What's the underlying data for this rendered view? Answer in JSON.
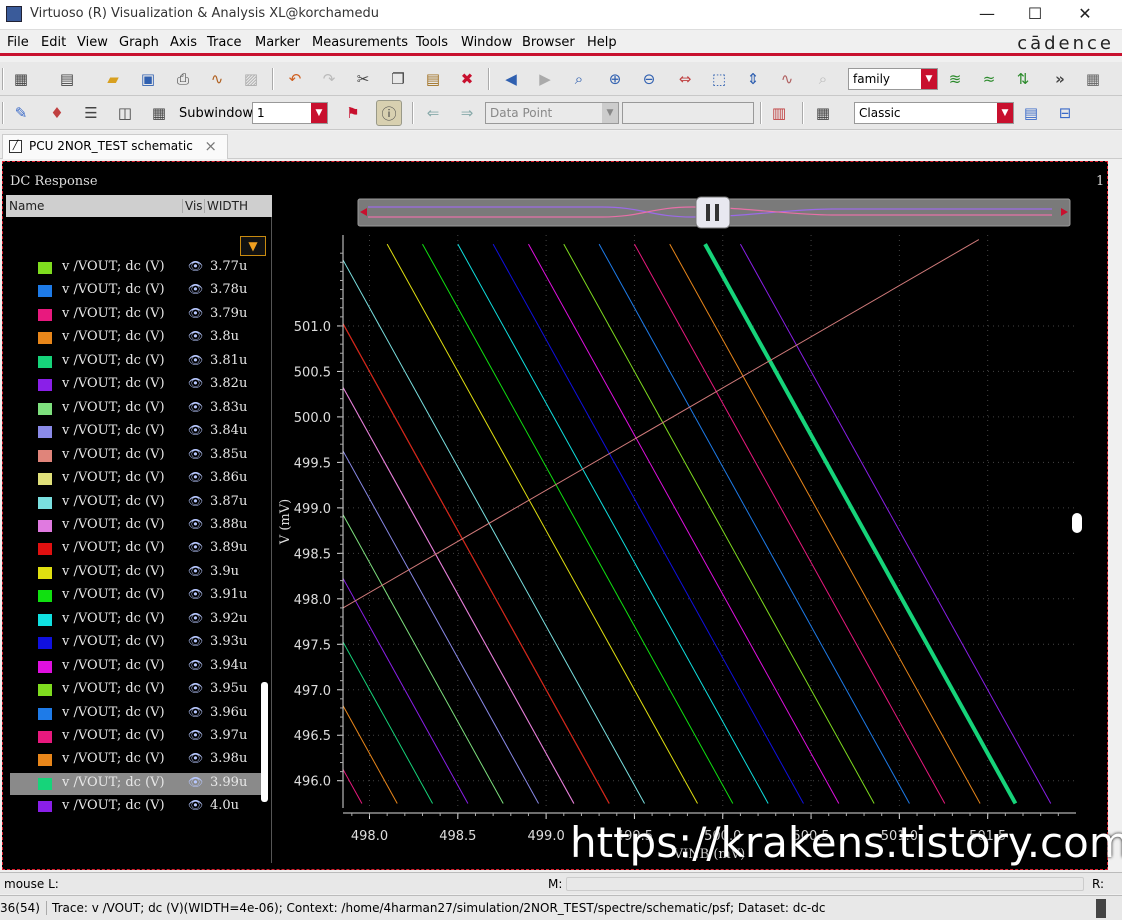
{
  "window": {
    "title": "Virtuoso (R) Visualization & Analysis XL@korchamedu",
    "minimize": "—",
    "maximize": "☐",
    "close": "✕"
  },
  "menu": {
    "items": [
      "File",
      "Edit",
      "View",
      "Graph",
      "Axis",
      "Trace",
      "Marker",
      "Measurements",
      "Tools",
      "Window",
      "Browser",
      "Help"
    ],
    "brand": "cādence"
  },
  "toolbar1": {
    "family_combo": "family",
    "more": "»"
  },
  "toolbar2": {
    "subwindow_label": "Subwindow:",
    "subwindow_value": "1",
    "datapoint_combo": "Data Point",
    "style_combo": "Classic"
  },
  "tab": {
    "label": "PCU 2NOR_TEST schematic",
    "close": "×"
  },
  "panel": {
    "title": "DC Response",
    "corner_number": "1",
    "columns": [
      "Name",
      "Vis",
      "WIDTH"
    ]
  },
  "traces": [
    {
      "name": "v /VOUT; dc (V)",
      "width": "3.77u",
      "color": "#7fdc1f"
    },
    {
      "name": "v /VOUT; dc (V)",
      "width": "3.78u",
      "color": "#1e7be8"
    },
    {
      "name": "v /VOUT; dc (V)",
      "width": "3.79u",
      "color": "#e8197e"
    },
    {
      "name": "v /VOUT; dc (V)",
      "width": "3.8u",
      "color": "#e8861a"
    },
    {
      "name": "v /VOUT; dc (V)",
      "width": "3.81u",
      "color": "#16d47a"
    },
    {
      "name": "v /VOUT; dc (V)",
      "width": "3.82u",
      "color": "#8a1fe8"
    },
    {
      "name": "v /VOUT; dc (V)",
      "width": "3.83u",
      "color": "#7ee07e"
    },
    {
      "name": "v /VOUT; dc (V)",
      "width": "3.84u",
      "color": "#8a8ae8"
    },
    {
      "name": "v /VOUT; dc (V)",
      "width": "3.85u",
      "color": "#e0847a"
    },
    {
      "name": "v /VOUT; dc (V)",
      "width": "3.86u",
      "color": "#e0e07a"
    },
    {
      "name": "v /VOUT; dc (V)",
      "width": "3.87u",
      "color": "#7ae0e0"
    },
    {
      "name": "v /VOUT; dc (V)",
      "width": "3.88u",
      "color": "#e07ae0"
    },
    {
      "name": "v /VOUT; dc (V)",
      "width": "3.89u",
      "color": "#e01010"
    },
    {
      "name": "v /VOUT; dc (V)",
      "width": "3.9u",
      "color": "#e0e010"
    },
    {
      "name": "v /VOUT; dc (V)",
      "width": "3.91u",
      "color": "#10e010"
    },
    {
      "name": "v /VOUT; dc (V)",
      "width": "3.92u",
      "color": "#10e0e0"
    },
    {
      "name": "v /VOUT; dc (V)",
      "width": "3.93u",
      "color": "#1010e0"
    },
    {
      "name": "v /VOUT; dc (V)",
      "width": "3.94u",
      "color": "#e010e0"
    },
    {
      "name": "v /VOUT; dc (V)",
      "width": "3.95u",
      "color": "#7fdc1f"
    },
    {
      "name": "v /VOUT; dc (V)",
      "width": "3.96u",
      "color": "#1e7be8"
    },
    {
      "name": "v /VOUT; dc (V)",
      "width": "3.97u",
      "color": "#e8197e"
    },
    {
      "name": "v /VOUT; dc (V)",
      "width": "3.98u",
      "color": "#e8861a"
    },
    {
      "name": "v /VOUT; dc (V)",
      "width": "3.99u",
      "color": "#16d47a",
      "selected": true
    },
    {
      "name": "v /VOUT; dc (V)",
      "width": "4.0u",
      "color": "#8a1fe8"
    }
  ],
  "chart_data": {
    "type": "line",
    "xlabel": "VINB (mV)",
    "ylabel": "V (mV)",
    "xlim": [
      497.85,
      502.0
    ],
    "ylim": [
      495.7,
      502.0
    ],
    "xticks": [
      "498.0",
      "498.5",
      "499.0",
      "499.5",
      "500.0",
      "500.5",
      "501.0",
      "501.5"
    ],
    "yticks": [
      "501.0",
      "500.5",
      "500.0",
      "499.5",
      "499.0",
      "498.5",
      "498.0",
      "497.5",
      "497.0",
      "496.5",
      "496.0"
    ],
    "grid": true,
    "series_slope_mV_per_mV": -3.5,
    "series": [
      {
        "name": "3.77u",
        "color": "#7fdc1f",
        "x_at_501_9": 495.8
      },
      {
        "name": "3.78u",
        "color": "#1e7be8",
        "x_at_501_9": 496.0
      },
      {
        "name": "3.79u",
        "color": "#e8197e",
        "x_at_501_9": 496.2
      },
      {
        "name": "3.8u",
        "color": "#e8861a",
        "x_at_501_9": 496.4
      },
      {
        "name": "3.81u",
        "color": "#16d47a",
        "x_at_501_9": 496.6
      },
      {
        "name": "3.82u",
        "color": "#8a1fe8",
        "x_at_501_9": 496.8
      },
      {
        "name": "3.83u",
        "color": "#7ee07e",
        "x_at_501_9": 497.0
      },
      {
        "name": "3.84u",
        "color": "#8a8ae8",
        "x_at_501_9": 497.2
      },
      {
        "name": "3.85u",
        "color": "#e0847a",
        "x_at_501_9": 497.4
      },
      {
        "name": "3.86u",
        "color": "#e0e07a",
        "x_at_501_9": 497.6
      },
      {
        "name": "3.87u",
        "color": "#7ae0e0",
        "x_at_501_9": 497.8
      },
      {
        "name": "3.88u",
        "color": "#e07ae0",
        "x_at_501_9": 497.4
      },
      {
        "name": "3.89u",
        "color": "#e01010",
        "x_at_501_9": 497.6
      },
      {
        "name": "3.9u",
        "color": "#e0e010",
        "x_at_501_9": 498.1
      },
      {
        "name": "3.91u",
        "color": "#10e010",
        "x_at_501_9": 498.3
      },
      {
        "name": "3.92u",
        "color": "#10e0e0",
        "x_at_501_9": 498.5
      },
      {
        "name": "3.93u",
        "color": "#1010e0",
        "x_at_501_9": 498.7
      },
      {
        "name": "3.94u",
        "color": "#e010e0",
        "x_at_501_9": 498.9
      },
      {
        "name": "3.95u",
        "color": "#7fdc1f",
        "x_at_501_9": 499.1
      },
      {
        "name": "3.96u",
        "color": "#1e7be8",
        "x_at_501_9": 499.3
      },
      {
        "name": "3.97u",
        "color": "#e8197e",
        "x_at_501_9": 499.5
      },
      {
        "name": "3.98u",
        "color": "#e8861a",
        "x_at_501_9": 499.7
      },
      {
        "name": "3.99u",
        "color": "#16d47a",
        "x_at_501_9": 499.9,
        "highlight": true
      },
      {
        "name": "4.0u",
        "color": "#8a1fe8",
        "x_at_501_9": 500.1
      }
    ],
    "reference_line": {
      "color": "#d07a7a",
      "x": [
        497.85,
        501.45
      ],
      "y": [
        497.9,
        501.95
      ]
    }
  },
  "status": {
    "mouse_label": "mouse L:",
    "m_label": "M:",
    "r_label": "R:",
    "counter": "36(54)",
    "message": "Trace: v /VOUT; dc (V)(WIDTH=4e-06); Context: /home/4harman27/simulation/2NOR_TEST/spectre/schematic/psf; Dataset: dc-dc"
  },
  "watermark": "https://krakens.tistory.com"
}
